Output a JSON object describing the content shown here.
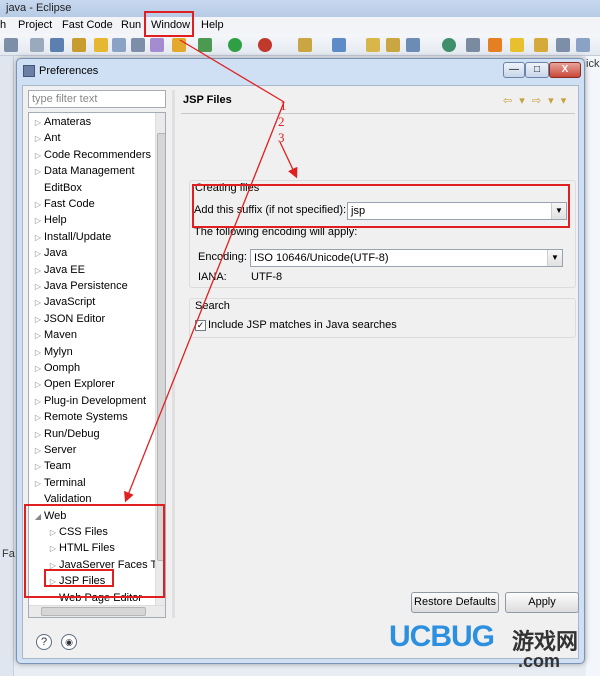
{
  "eclipse": {
    "title": "java - Eclipse",
    "menu": [
      "h",
      "Project",
      "Fast Code",
      "Run",
      "Window",
      "Help"
    ],
    "left_strip_label": "Fa",
    "right_tab_label": "ick"
  },
  "dialog": {
    "title": "Preferences",
    "buttons": {
      "minimize": "—",
      "maximize": "□",
      "close": "X"
    }
  },
  "sidebar": {
    "filter_placeholder": "type filter text",
    "items": [
      {
        "label": "Amateras",
        "expand": "▷"
      },
      {
        "label": "Ant",
        "expand": "▷"
      },
      {
        "label": "Code Recommenders",
        "expand": "▷"
      },
      {
        "label": "Data Management",
        "expand": "▷"
      },
      {
        "label": "EditBox",
        "expand": ""
      },
      {
        "label": "Fast Code",
        "expand": "▷"
      },
      {
        "label": "Help",
        "expand": "▷"
      },
      {
        "label": "Install/Update",
        "expand": "▷"
      },
      {
        "label": "Java",
        "expand": "▷"
      },
      {
        "label": "Java EE",
        "expand": "▷"
      },
      {
        "label": "Java Persistence",
        "expand": "▷"
      },
      {
        "label": "JavaScript",
        "expand": "▷"
      },
      {
        "label": "JSON Editor",
        "expand": "▷"
      },
      {
        "label": "Maven",
        "expand": "▷"
      },
      {
        "label": "Mylyn",
        "expand": "▷"
      },
      {
        "label": "Oomph",
        "expand": "▷"
      },
      {
        "label": "Open Explorer",
        "expand": "▷"
      },
      {
        "label": "Plug-in Development",
        "expand": "▷"
      },
      {
        "label": "Remote Systems",
        "expand": "▷"
      },
      {
        "label": "Run/Debug",
        "expand": "▷"
      },
      {
        "label": "Server",
        "expand": "▷"
      },
      {
        "label": "Team",
        "expand": "▷"
      },
      {
        "label": "Terminal",
        "expand": "▷"
      },
      {
        "label": "Validation",
        "expand": ""
      },
      {
        "label": "Web",
        "expand": "◢"
      }
    ],
    "web_children": [
      {
        "label": "CSS Files",
        "expand": "▷"
      },
      {
        "label": "HTML Files",
        "expand": "▷"
      },
      {
        "label": "JavaServer Faces T",
        "expand": "▷"
      },
      {
        "label": "JSP Files",
        "expand": "▷"
      },
      {
        "label": "Web Page Editor",
        "expand": ""
      }
    ]
  },
  "page": {
    "title": "JSP Files",
    "creating_files": {
      "heading": "Creating files",
      "suffix_label": "Add this suffix (if not specified):",
      "suffix_value": "jsp",
      "encoding_note": "The following encoding will apply:",
      "encoding_label": "Encoding:",
      "encoding_value": "ISO 10646/Unicode(UTF-8)",
      "iana_label": "IANA:",
      "iana_value": "UTF-8"
    },
    "search": {
      "heading": "Search",
      "checkbox_label": "Include JSP matches in Java searches",
      "checked": true
    },
    "restore_defaults": "Restore Defaults",
    "apply": "Apply"
  },
  "annotations": {
    "step1": "1",
    "step2": "2",
    "step3": "3"
  },
  "watermark": {
    "brand": "UCBUG",
    "cn": "游戏网",
    "com": ".com"
  },
  "colors": {
    "annotation_red": "#e02020",
    "dialog_frame": "#cfe0f4"
  }
}
